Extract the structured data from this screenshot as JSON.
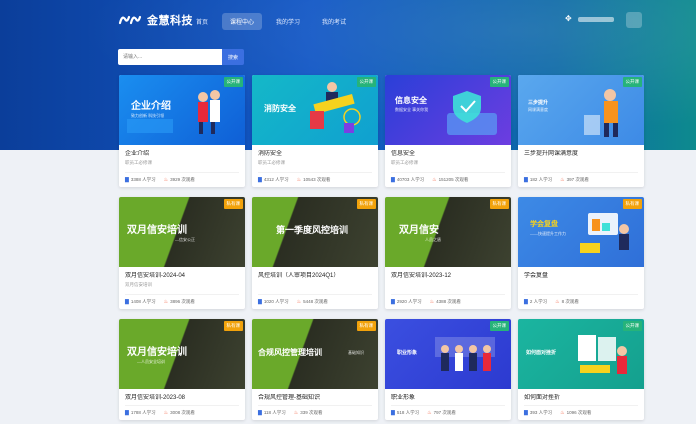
{
  "brand": {
    "name": "金慧科技"
  },
  "nav": [
    {
      "label": "首页",
      "active": false
    },
    {
      "label": "课程中心",
      "active": true
    },
    {
      "label": "我的学习",
      "active": false
    },
    {
      "label": "我的考试",
      "active": false
    }
  ],
  "search": {
    "placeholder": "请输入...",
    "button_label": "搜索"
  },
  "cards": [
    {
      "title": "企业介绍",
      "sub": "职员工必修课",
      "badge": "公开课",
      "badge_type": "public",
      "learners": "3388 人学习",
      "views": "3929 次观看",
      "thumb_title": "企业介绍",
      "thumb_sub": "致力创新 科技引领"
    },
    {
      "title": "消防安全",
      "sub": "职员工必修课",
      "badge": "公开课",
      "badge_type": "public",
      "learners": "4312 人学习",
      "views": "10543 次观看",
      "thumb_title": "消防安全",
      "thumb_sub": ""
    },
    {
      "title": "信息安全",
      "sub": "职员工必修课",
      "badge": "公开课",
      "badge_type": "public",
      "learners": "40703 人学习",
      "views": "151205 次观看",
      "thumb_title": "信息安全",
      "thumb_sub": "数据安全 事关你我"
    },
    {
      "title": "三步提升网课满意度",
      "sub": "",
      "badge": "公开课",
      "badge_type": "public",
      "learners": "182 人学习",
      "views": "397 次观看",
      "thumb_title": "三步提升",
      "thumb_sub": "网课满意度"
    },
    {
      "title": "双月信安培训-2024-04",
      "sub": "双月信安培训",
      "badge": "私有课",
      "badge_type": "private",
      "learners": "1408 人学习",
      "views": "3896 次观看",
      "thumb_title": "双月信安培训",
      "thumb_sub": "—信安公正"
    },
    {
      "title": "风控培训（人审项目2024Q1）",
      "sub": "",
      "badge": "私有课",
      "badge_type": "private",
      "learners": "1020 人学习",
      "views": "5448 次观看",
      "thumb_title": "第一季度风控培训",
      "thumb_sub": ""
    },
    {
      "title": "双月信安培训-2023-12",
      "sub": "",
      "badge": "私有课",
      "badge_type": "private",
      "learners": "2920 人学习",
      "views": "4388 次观看",
      "thumb_title": "双月信安",
      "thumb_sub": "人员之盾"
    },
    {
      "title": "学会复盘",
      "sub": "",
      "badge": "私有课",
      "badge_type": "private",
      "learners": "2 人学习",
      "views": "8 次观看",
      "thumb_title": "学会复盘",
      "thumb_sub": "——快速提升工作力"
    },
    {
      "title": "双月信安培训-2023-08",
      "sub": "",
      "badge": "私有课",
      "badge_type": "private",
      "learners": "1788 人学习",
      "views": "3008 次观看",
      "thumb_title": "双月信安培训",
      "thumb_sub": "—人员安全培训"
    },
    {
      "title": "合规风控管理-基础知识",
      "sub": "",
      "badge": "私有课",
      "badge_type": "private",
      "learners": "118 人学习",
      "views": "339 次观看",
      "thumb_title": "合规风控管理培训",
      "thumb_sub": "基础知识"
    },
    {
      "title": "职业形象",
      "sub": "",
      "badge": "公开课",
      "badge_type": "public",
      "learners": "518 人学习",
      "views": "797 次观看",
      "thumb_title": "职业形象",
      "thumb_sub": ""
    },
    {
      "title": "如何面对挫折",
      "sub": "",
      "badge": "公开课",
      "badge_type": "public",
      "learners": "393 人学习",
      "views": "1096 次观看",
      "thumb_title": "如何面对挫折",
      "thumb_sub": ""
    }
  ]
}
